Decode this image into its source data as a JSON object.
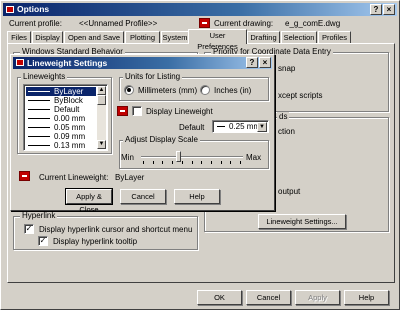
{
  "window": {
    "title": "Options",
    "help_btn": "?",
    "close_btn": "×"
  },
  "profile": {
    "label": "Current profile:",
    "value": "<<Unnamed Profile>>",
    "drawing_label": "Current drawing:",
    "drawing_value": "e_g_comE.dwg"
  },
  "tabs": [
    "Files",
    "Display",
    "Open and Save",
    "Plotting",
    "System",
    "User Preferences",
    "Drafting",
    "Selection",
    "Profiles"
  ],
  "bg": {
    "left_group_title": "Windows Standard Behavior",
    "right_group_title": "Priority for Coordinate Data Entry",
    "snap_text": "snap",
    "except_text": "xcept scripts",
    "ds_text": "ds",
    "ction_text": "ction",
    "output_text": "output",
    "hyperlink_title": "Hyperlink",
    "hyperlink_cursor": "Display hyperlink cursor and shortcut menu",
    "hyperlink_tooltip": "Display hyperlink tooltip",
    "lineweight_settings_btn": "Lineweight Settings..."
  },
  "footer": {
    "ok": "OK",
    "cancel": "Cancel",
    "apply": "Apply",
    "help": "Help"
  },
  "dialog": {
    "title": "Lineweight Settings",
    "help_btn": "?",
    "close_btn": "×",
    "lineweights_title": "Lineweights",
    "lineweights": [
      "ByLayer",
      "ByBlock",
      "Default",
      "0.00 mm",
      "0.05 mm",
      "0.09 mm",
      "0.13 mm"
    ],
    "selected_index": 0,
    "units_title": "Units for Listing",
    "unit_mm": "Millimeters (mm)",
    "unit_in": "Inches (in)",
    "unit_selected": "mm",
    "display_lineweight": "Display Lineweight",
    "display_lineweight_checked": false,
    "default_label": "Default",
    "default_value": "0.25 mm",
    "scale_title": "Adjust Display Scale",
    "scale_min": "Min",
    "scale_max": "Max",
    "scale_level": 0.36,
    "current_label": "Current Lineweight:",
    "current_value": "ByLayer",
    "apply_close": "Apply & Close",
    "cancel": "Cancel",
    "help": "Help"
  }
}
